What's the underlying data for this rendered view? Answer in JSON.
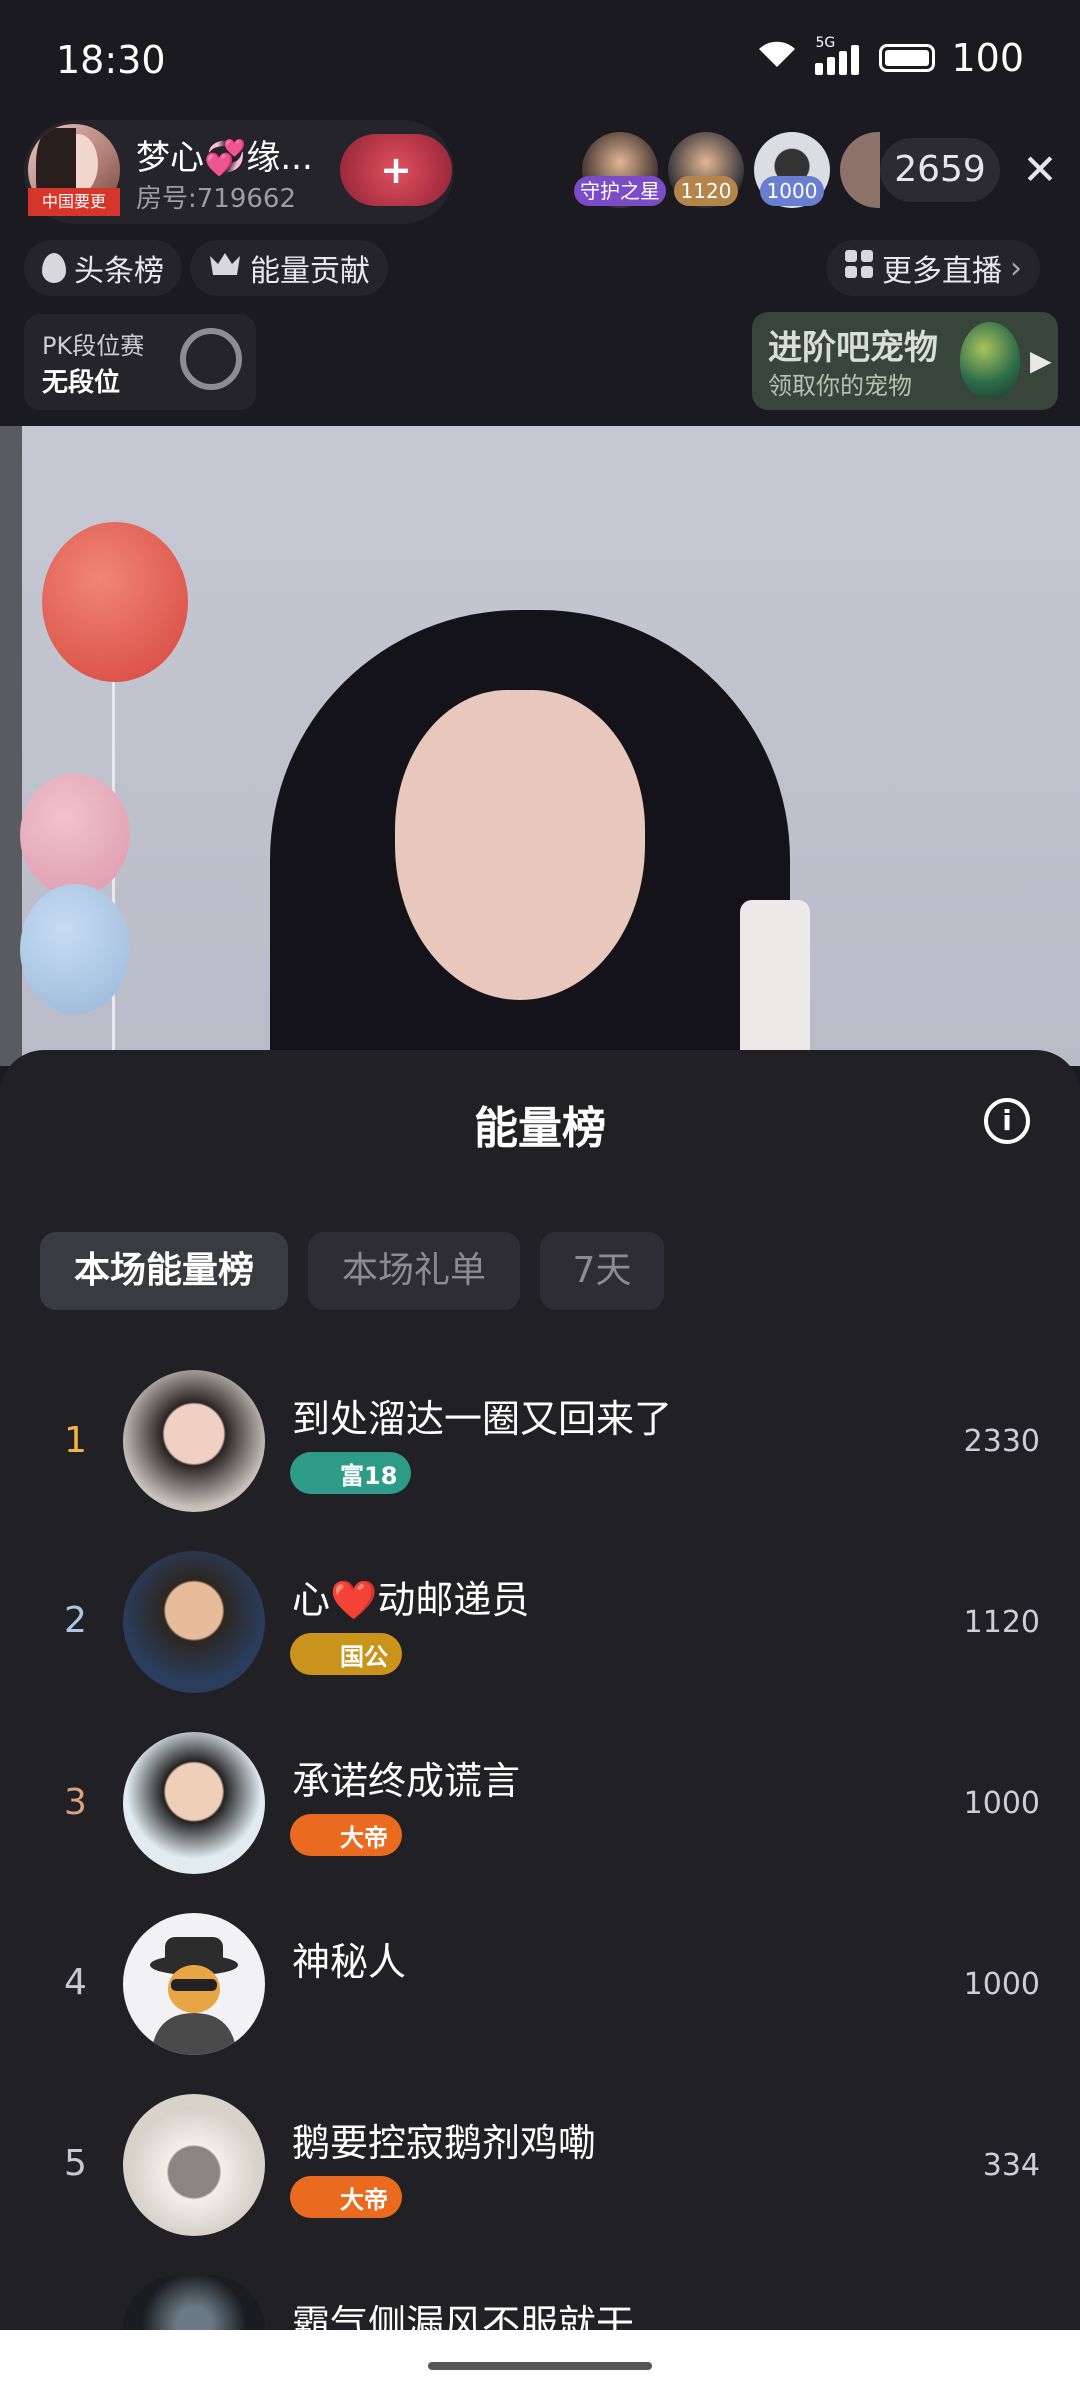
{
  "status_bar": {
    "time": "18:30",
    "network": "5G",
    "battery": "100"
  },
  "header": {
    "host_name": "梦心💞缘...",
    "room_id": "房号:719662",
    "host_avatar_tag": "中国要更",
    "follow_icon": "plus-heart-icon",
    "viewers": [
      {
        "badge": "守护之星",
        "badge_color": "#7a4cc7"
      },
      {
        "badge": "1120",
        "badge_color": "#b3854a"
      },
      {
        "badge": "1000",
        "badge_color": "#6a7ed1"
      },
      {
        "badge": ""
      }
    ],
    "viewer_count": "2659",
    "close_icon": "close-icon"
  },
  "toolbar": {
    "headline_label": "头条榜",
    "energy_label": "能量贡献",
    "more_live_label": "更多直播"
  },
  "pk": {
    "title": "PK段位赛",
    "value": "无段位"
  },
  "pet": {
    "title": "进阶吧宠物",
    "subtitle": "领取你的宠物"
  },
  "sheet": {
    "title": "能量榜",
    "tabs": [
      {
        "label": "本场能量榜",
        "active": true
      },
      {
        "label": "本场礼单",
        "active": false
      },
      {
        "label": "7天",
        "active": false
      }
    ],
    "ranking": [
      {
        "rank": "1",
        "name": "到处溜达一圈又回来了",
        "badge": "富18",
        "score": "2330",
        "rank_color": "#f2b544"
      },
      {
        "rank": "2",
        "name": "心❤️动邮递员",
        "badge": "国公",
        "score": "1120",
        "rank_color": "#a9c6e6"
      },
      {
        "rank": "3",
        "name": "承诺终成谎言",
        "badge": "大帝",
        "score": "1000",
        "rank_color": "#dba37c"
      },
      {
        "rank": "4",
        "name": "神秘人",
        "badge": "",
        "score": "1000",
        "rank_color": "#c9c8ce"
      },
      {
        "rank": "5",
        "name": "鹅要控寂鹅剂鸡嘞",
        "badge": "大帝",
        "score": "334",
        "rank_color": "#c9c8ce"
      },
      {
        "rank": "",
        "name": "霸气侧漏风不服就干",
        "badge": "",
        "score": "",
        "rank_color": "#c9c8ce"
      }
    ]
  }
}
